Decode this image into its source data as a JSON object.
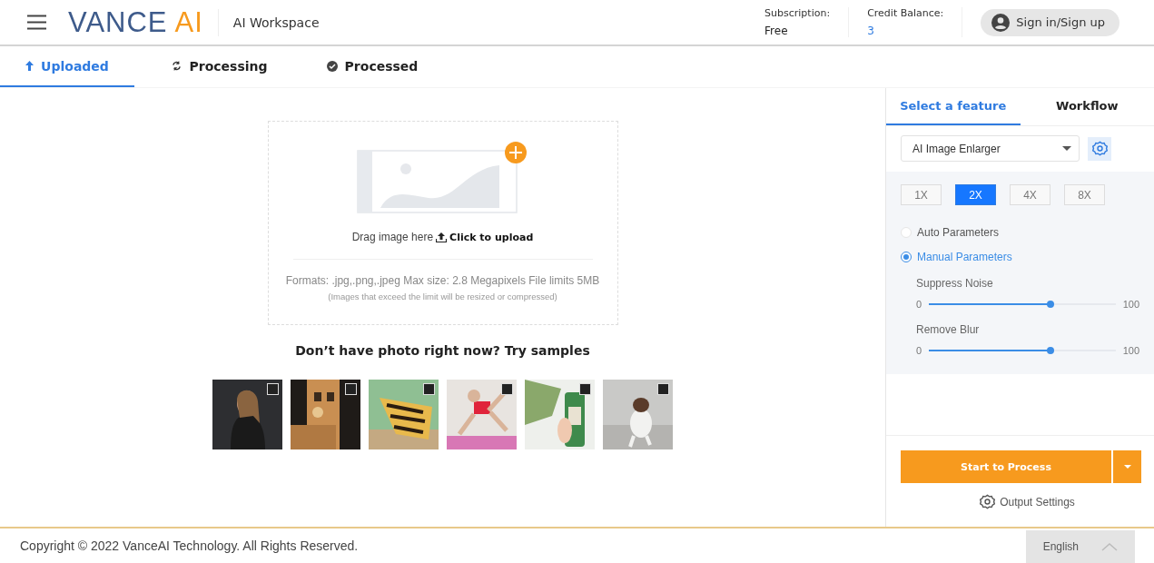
{
  "header": {
    "logo": {
      "main": "VANCE",
      "accent": "AI"
    },
    "workspace": "AI Workspace",
    "stats": [
      {
        "label": "Subscription:",
        "value": "Free",
        "highlight": false
      },
      {
        "label": "Credit Balance:",
        "value": "3",
        "highlight": true
      }
    ],
    "sign_in": "Sign in/Sign up"
  },
  "tabs": [
    {
      "label": "Uploaded",
      "kind": "upload",
      "selected": true
    },
    {
      "label": "Processing",
      "kind": "sync",
      "selected": false
    },
    {
      "label": "Processed",
      "kind": "done",
      "selected": false
    }
  ],
  "upload": {
    "drag": "Drag image here",
    "click": "Click to upload",
    "formats": "Formats: .jpg,.png,.jpeg Max size: 2.8 Megapixels File limits 5MB",
    "note": "(Images that exceed the limit will be resized or compressed)"
  },
  "samples": {
    "title": "Don’t have photo right now? Try samples"
  },
  "panel": {
    "tabs": [
      {
        "label": "Select a feature",
        "selected": true
      },
      {
        "label": "Workflow",
        "selected": false
      }
    ],
    "feature": "AI Image Enlarger",
    "scales": [
      {
        "label": "1X",
        "selected": false
      },
      {
        "label": "2X",
        "selected": true
      },
      {
        "label": "4X",
        "selected": false
      },
      {
        "label": "8X",
        "selected": false
      }
    ],
    "modes": [
      {
        "label": "Auto Parameters",
        "selected": false
      },
      {
        "label": "Manual Parameters",
        "selected": true
      }
    ],
    "sliders": [
      {
        "label": "Suppress Noise",
        "min": "0",
        "max": "100",
        "level": 0.65
      },
      {
        "label": "Remove Blur",
        "min": "0",
        "max": "100",
        "level": 0.65
      }
    ],
    "process": "Start to Process",
    "output": "Output Settings"
  },
  "footer": {
    "copyright": "Copyright © 2022 VanceAI Technology. All Rights Reserved.",
    "language": "English"
  }
}
